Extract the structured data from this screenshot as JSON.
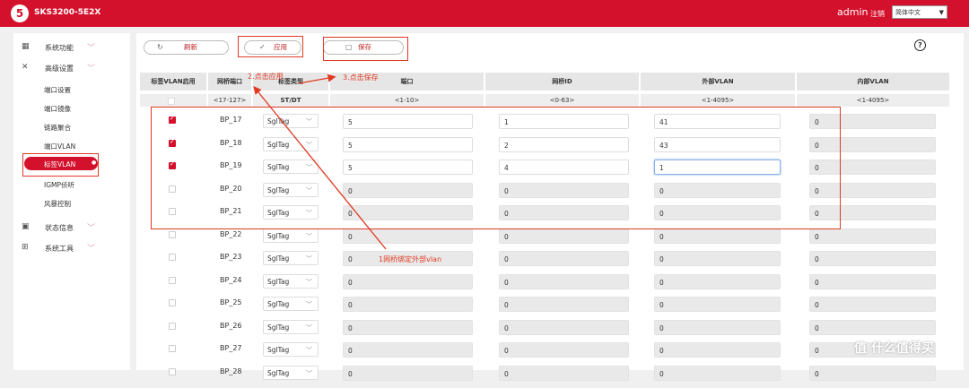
{
  "header": {
    "logo_glyph": "5",
    "device_name": "SKS3200-5E2X",
    "user": "admin",
    "logout": "注销",
    "language": "简体中文"
  },
  "sidebar": {
    "groups": [
      {
        "label": "系统功能",
        "icon": "grid-icon",
        "glyph": "▦"
      },
      {
        "label": "高级设置",
        "icon": "wrench-icon",
        "glyph": "✕"
      },
      {
        "label": "状态信息",
        "icon": "monitor-icon",
        "glyph": "▣"
      },
      {
        "label": "系统工具",
        "icon": "toolbox-icon",
        "glyph": "⊞"
      }
    ],
    "sub_items": [
      "端口设置",
      "端口镜像",
      "链路聚合",
      "端口VLAN",
      "标签VLAN",
      "IGMP侦听",
      "风暴控制"
    ],
    "chevron": "﹀",
    "active_dot": "●"
  },
  "toolbar": {
    "refresh_label": "刷新",
    "refresh_glyph": "↻",
    "apply_label": "应用",
    "apply_glyph": "✓",
    "save_label": "保存",
    "save_glyph": "▢",
    "help_glyph": "?"
  },
  "table": {
    "headers": [
      "标签VLAN启用",
      "网桥端口",
      "标签类型",
      "端口",
      "网桥ID",
      "外部VLAN",
      "内部VLAN"
    ],
    "ranges": [
      "<17-127>",
      "ST/DT",
      "<1-10>",
      "<0-63>",
      "<1-4095>",
      "<1-4095>"
    ],
    "rows": [
      {
        "enabled": true,
        "bp": "BP_17",
        "type": "SglTag",
        "port": "5",
        "bridge": "1",
        "outer": "41",
        "inner": "0",
        "editable": true
      },
      {
        "enabled": true,
        "bp": "BP_18",
        "type": "SglTag",
        "port": "5",
        "bridge": "2",
        "outer": "43",
        "inner": "0",
        "editable": true
      },
      {
        "enabled": true,
        "bp": "BP_19",
        "type": "SglTag",
        "port": "5",
        "bridge": "4",
        "outer": "1",
        "inner": "0",
        "editable": true
      },
      {
        "enabled": false,
        "bp": "BP_20",
        "type": "SglTag",
        "port": "0",
        "bridge": "0",
        "outer": "0",
        "inner": "0",
        "editable": false
      },
      {
        "enabled": false,
        "bp": "BP_21",
        "type": "SglTag",
        "port": "0",
        "bridge": "0",
        "outer": "0",
        "inner": "0",
        "editable": false
      },
      {
        "enabled": false,
        "bp": "BP_22",
        "type": "SglTag",
        "port": "0",
        "bridge": "0",
        "outer": "0",
        "inner": "0",
        "editable": false
      },
      {
        "enabled": false,
        "bp": "BP_23",
        "type": "SglTag",
        "port": "0",
        "bridge": "0",
        "outer": "0",
        "inner": "0",
        "editable": false
      },
      {
        "enabled": false,
        "bp": "BP_24",
        "type": "SglTag",
        "port": "0",
        "bridge": "0",
        "outer": "0",
        "inner": "0",
        "editable": false
      },
      {
        "enabled": false,
        "bp": "BP_25",
        "type": "SglTag",
        "port": "0",
        "bridge": "0",
        "outer": "0",
        "inner": "0",
        "editable": false
      },
      {
        "enabled": false,
        "bp": "BP_26",
        "type": "SglTag",
        "port": "0",
        "bridge": "0",
        "outer": "0",
        "inner": "0",
        "editable": false
      },
      {
        "enabled": false,
        "bp": "BP_27",
        "type": "SglTag",
        "port": "0",
        "bridge": "0",
        "outer": "0",
        "inner": "0",
        "editable": false
      },
      {
        "enabled": false,
        "bp": "BP_28",
        "type": "SglTag",
        "port": "0",
        "bridge": "0",
        "outer": "0",
        "inner": "0",
        "editable": false
      }
    ]
  },
  "annotations": {
    "apply_note": "2.点击应用",
    "save_note": "3.点击保存",
    "bind_note": "1网桥绑定外部vlan"
  },
  "watermark": "值 什么值得买",
  "colors": {
    "brand": "#d4112c",
    "annotation": "#e03a22"
  }
}
